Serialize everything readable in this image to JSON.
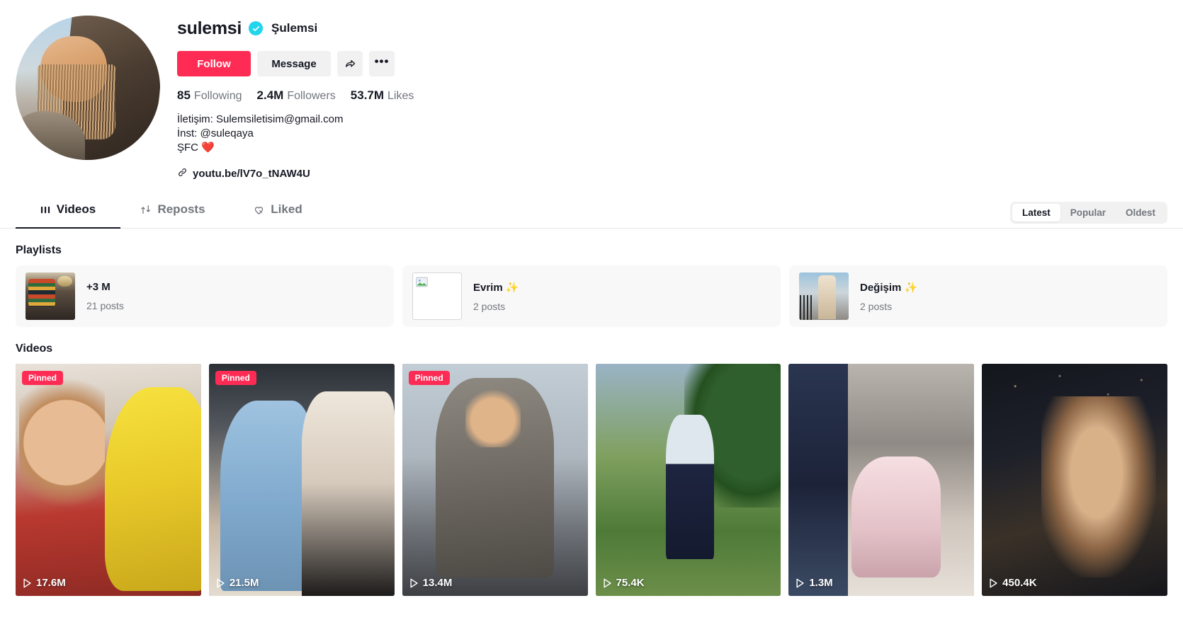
{
  "profile": {
    "username": "sulemsi",
    "nickname": "Şulemsi",
    "verified_icon": "verified-check-icon",
    "avatar_icon": "profile-avatar",
    "follow_label": "Follow",
    "message_label": "Message",
    "share_icon": "share-arrow-icon",
    "more_icon": "more-options-icon",
    "more_glyph": "•••",
    "stats": [
      {
        "num": "85",
        "label": "Following"
      },
      {
        "num": "2.4M",
        "label": "Followers"
      },
      {
        "num": "53.7M",
        "label": "Likes"
      }
    ],
    "bio": "İletişim: Sulemsiletisim@gmail.com\nİnst: @suleqaya\nŞFC ❤️",
    "link_icon": "link-chain-icon",
    "link_text": "youtu.be/lV7o_tNAW4U"
  },
  "tabs": [
    {
      "label": "Videos",
      "icon": "grid-videos-icon",
      "active": true
    },
    {
      "label": "Reposts",
      "icon": "repost-arrows-icon",
      "active": false
    },
    {
      "label": "Liked",
      "icon": "heart-locked-icon",
      "active": false
    }
  ],
  "sort": {
    "options": [
      "Latest",
      "Popular",
      "Oldest"
    ],
    "selected": "Latest"
  },
  "sections": {
    "playlists_title": "Playlists",
    "videos_title": "Videos"
  },
  "playlists": [
    {
      "title": "+3 M",
      "count": "21 posts",
      "thumb": "playlist-thumb-room",
      "broken": false
    },
    {
      "title": "Evrim ✨",
      "count": "2 posts",
      "thumb": "playlist-thumb-missing",
      "broken": true
    },
    {
      "title": "Değişim ✨",
      "count": "2 posts",
      "thumb": "playlist-thumb-balcony",
      "broken": false
    }
  ],
  "videos": [
    {
      "views": "17.6M",
      "pinned": true,
      "pinned_label": "Pinned",
      "thumb": "video-thumb-1"
    },
    {
      "views": "21.5M",
      "pinned": true,
      "pinned_label": "Pinned",
      "thumb": "video-thumb-2"
    },
    {
      "views": "13.4M",
      "pinned": true,
      "pinned_label": "Pinned",
      "thumb": "video-thumb-3"
    },
    {
      "views": "75.4K",
      "pinned": false,
      "pinned_label": "",
      "thumb": "video-thumb-4"
    },
    {
      "views": "1.3M",
      "pinned": false,
      "pinned_label": "",
      "thumb": "video-thumb-5"
    },
    {
      "views": "450.4K",
      "pinned": false,
      "pinned_label": "",
      "thumb": "video-thumb-6"
    }
  ],
  "colors": {
    "accent_red": "#fe2c55",
    "verified_blue": "#20d5ec",
    "text_primary": "#161823",
    "text_secondary": "#72767c",
    "surface": "#f1f1f2"
  }
}
